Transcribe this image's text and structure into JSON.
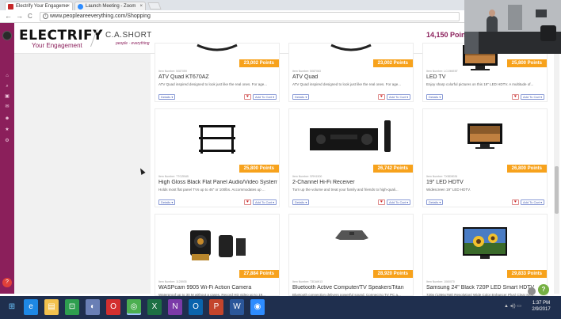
{
  "browser": {
    "tabs": [
      {
        "title": "Electrify Your Engageme",
        "close": "×",
        "favicon_color": "#c62828"
      },
      {
        "title": "Launch Meeting - Zoom",
        "close": "×",
        "favicon_color": "#2d8cff"
      }
    ],
    "nav": {
      "back": "←",
      "forward": "→",
      "reload": "C"
    },
    "url": "www.peoplearеeverything.com/Shopping",
    "url_info": "i"
  },
  "app": {
    "brand": "ELECTRIFY",
    "brand_sub": "Your Engagement",
    "partner": "C.A.SHORT",
    "partner_tag": "people · everything",
    "points_total": "14,150 Points",
    "accent": "#8b1f5b",
    "rail_icons": [
      "home-icon",
      "search-icon",
      "gift-icon",
      "mail-icon",
      "users-icon",
      "star-icon",
      "settings-icon"
    ],
    "help_label": "?"
  },
  "products": [
    {
      "points": "23,002 Points",
      "item_no": "Item Number: 5087059",
      "name": "ATV Quad KT670AZ",
      "desc": "ATV Quad inspired designed to look just like the real ones. For age...",
      "art": "atv"
    },
    {
      "points": "23,002 Points",
      "item_no": "Item Number: 5087063",
      "name": "ATV Quad",
      "desc": "ATV Quad inspired designed to look just like the real ones. For age...",
      "art": "atv"
    },
    {
      "points": "25,800 Points",
      "item_no": "Item Number: LC19ME5T",
      "name": "LED TV",
      "desc": "Enjoy sharp colorful pictures on this 19\" LED HDTV. A multitude of...",
      "art": "tv"
    },
    {
      "points": "25,800 Points",
      "item_no": "Item Number: TTGZB4B",
      "name": "High Gloss Black Flat Panel Audio/Video System",
      "desc": "Holds most flat panel TVs up to 46\" or 100lbs. Accommodates up ...",
      "art": "stand"
    },
    {
      "points": "26,742 Points",
      "item_no": "Item Number: SRH1500",
      "name": "2-Channel Hi-Fi Receiver",
      "desc": "Turn up the volume and treat your family and friends to high-quali...",
      "art": "receiver"
    },
    {
      "points": "26,800 Points",
      "item_no": "Item Number: TXBD8026",
      "name": "19\" LED HDTV",
      "desc": "Widescreen 19\" LED HDTV.",
      "art": "tv"
    },
    {
      "points": "27,884 Points",
      "item_no": "Item Number: 1128935",
      "name": "WASPcam 9905 Wi-Fi Action Camera",
      "desc": "Waterproof up to 30 M without a cases. Record HD video up to 19...",
      "art": "camera"
    },
    {
      "points": "28,920 Points",
      "item_no": "Item Number: T3DAW13",
      "name": "Bluetooth Active Computer/TV SpeakersTitan",
      "desc": "Bluetooth connection delivers powerful sound. Connect to TV PC a...",
      "art": "speaker"
    },
    {
      "points": "29,833 Points",
      "item_no": "Item Number: 1060070",
      "name": "Samsung 24\" Black 720P LED Smart HDTV",
      "desc": "720p (1366x768) Resolution/ Wide Color Enhancer Plus/ Clear Moti...",
      "art": "sunflower-tv"
    }
  ],
  "card_buttons": {
    "details": "Details ▾",
    "add_to_cart": "Add To Cart ▾",
    "wishlist": "♥"
  },
  "taskbar": {
    "start": "⊞",
    "apps": [
      {
        "name": "ie-icon",
        "glyph": "e",
        "color": "#1e88e5"
      },
      {
        "name": "explorer-icon",
        "glyph": "▤",
        "color": "#f2c14e"
      },
      {
        "name": "store-icon",
        "glyph": "⊡",
        "color": "#2e9e4f"
      },
      {
        "name": "people-icon",
        "glyph": "◐",
        "color": "#6a7fb5"
      },
      {
        "name": "opera-icon",
        "glyph": "O",
        "color": "#d32f2f"
      },
      {
        "name": "chrome-icon",
        "glyph": "◎",
        "color": "#4caf50"
      },
      {
        "name": "excel-icon",
        "glyph": "X",
        "color": "#1d7044"
      },
      {
        "name": "onenote-icon",
        "glyph": "N",
        "color": "#7b3aa8"
      },
      {
        "name": "outlook-icon",
        "glyph": "O",
        "color": "#0a64ad"
      },
      {
        "name": "powerpoint-icon",
        "glyph": "P",
        "color": "#c4452c"
      },
      {
        "name": "word-icon",
        "glyph": "W",
        "color": "#2b579a"
      },
      {
        "name": "zoom-icon",
        "glyph": "◉",
        "color": "#2d8cff"
      }
    ],
    "tray": "▲ ◂)) ▭",
    "time": "1:37 PM",
    "date": "2/9/2017"
  }
}
